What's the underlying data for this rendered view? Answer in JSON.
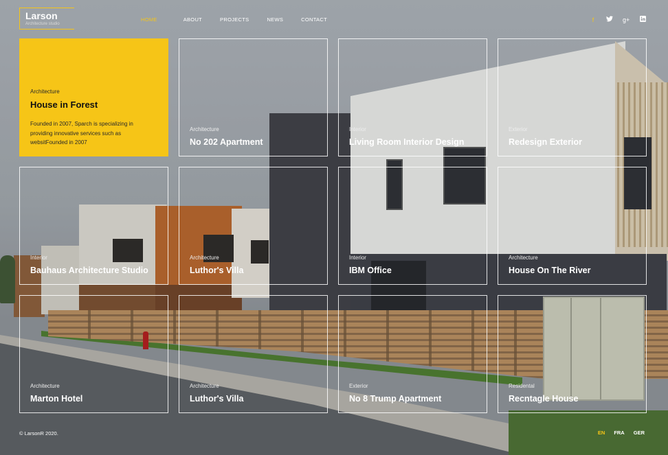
{
  "brand": {
    "name": "Larson",
    "tagline": "Architecture studio",
    "accent": "#f6c517"
  },
  "nav": [
    {
      "label": "HOME",
      "active": true
    },
    {
      "label": "ABOUT",
      "active": false
    },
    {
      "label": "PROJECTS",
      "active": false
    },
    {
      "label": "NEWS",
      "active": false
    },
    {
      "label": "CONTACT",
      "active": false
    }
  ],
  "social": [
    {
      "icon": "facebook-icon",
      "glyph": "f"
    },
    {
      "icon": "twitter-icon",
      "glyph": "🐦"
    },
    {
      "icon": "google-plus-icon",
      "glyph": "g+"
    },
    {
      "icon": "linkedin-icon",
      "glyph": "in"
    }
  ],
  "featured": {
    "category": "Architecture",
    "title": "House in Forest",
    "description": "Founded in 2007, Sparch is specializing in providing innovative services such as websitFounded in 2007"
  },
  "projects": [
    {
      "category": "Architecture",
      "title": "No 202 Apartment"
    },
    {
      "category": "Interior",
      "title": "Living Room Interior Design"
    },
    {
      "category": "Exterior",
      "title": "Redesign Exterior"
    },
    {
      "category": "Interior",
      "title": "Bauhaus Architecture Studio"
    },
    {
      "category": "Architecture",
      "title": "Luthor's Villa"
    },
    {
      "category": "Interior",
      "title": "IBM Office"
    },
    {
      "category": "Architecture",
      "title": "House On The River"
    },
    {
      "category": "Architecture",
      "title": "Marton Hotel"
    },
    {
      "category": "Architecture",
      "title": "Luthor's Villa"
    },
    {
      "category": "Exterior",
      "title": "No 8 Trump Apartment"
    },
    {
      "category": "Residental",
      "title": "Recntagle House"
    }
  ],
  "footer": {
    "copyright": "© LarsonR 2020.",
    "languages": [
      {
        "label": "EN",
        "active": true
      },
      {
        "label": "FRA",
        "active": false
      },
      {
        "label": "GER",
        "active": false
      }
    ]
  }
}
